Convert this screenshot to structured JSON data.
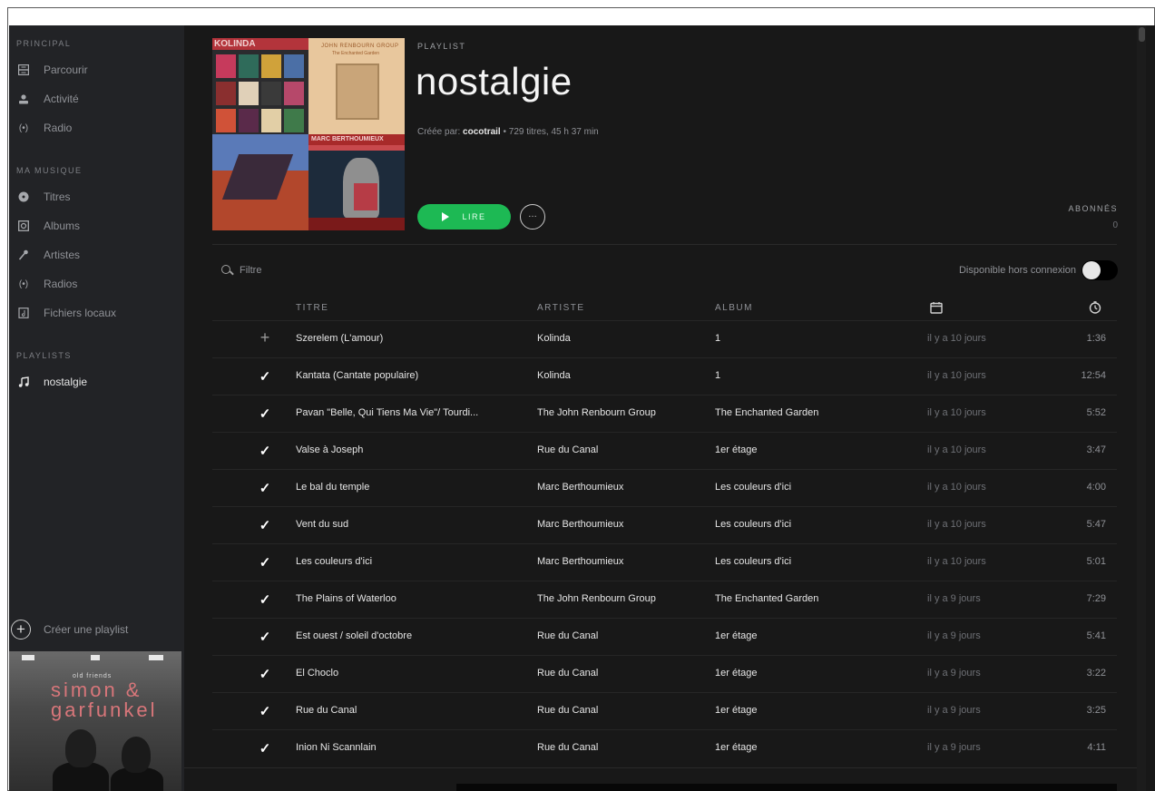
{
  "sidebar": {
    "sections": [
      {
        "title": "PRINCIPAL",
        "items": [
          {
            "label": "Parcourir",
            "icon": "browse-icon"
          },
          {
            "label": "Activité",
            "icon": "activity-icon"
          },
          {
            "label": "Radio",
            "icon": "radio-icon"
          }
        ]
      },
      {
        "title": "MA MUSIQUE",
        "items": [
          {
            "label": "Titres",
            "icon": "songs-icon"
          },
          {
            "label": "Albums",
            "icon": "albums-icon"
          },
          {
            "label": "Artistes",
            "icon": "artists-icon"
          },
          {
            "label": "Radios",
            "icon": "radios-icon"
          },
          {
            "label": "Fichiers locaux",
            "icon": "local-files-icon"
          }
        ]
      },
      {
        "title": "PLAYLISTS",
        "items": [
          {
            "label": "nostalgie",
            "icon": "playlist-icon"
          }
        ]
      }
    ],
    "create_playlist": "Créer une playlist",
    "now_playing_art": {
      "line1": "old friends",
      "line2": "simon &",
      "line3": "garfunkel"
    }
  },
  "playlist": {
    "type_label": "PLAYLIST",
    "title": "nostalgie",
    "created_by_label": "Créée par:",
    "owner": "cocotrail",
    "stats": "• 729 titres, 45 h 37 min",
    "play_label": "LIRE",
    "followers_label": "ABONNÉS",
    "followers_count": "0",
    "mosaic": {
      "tile1_title": "KOLINDA",
      "tile2_title": "JOHN RENBOURN GROUP",
      "tile2_sub": "The Enchanted Garden",
      "tile4_title": "MARC BERTHOUMIEUX"
    }
  },
  "filter": {
    "placeholder": "Filtre"
  },
  "offline": {
    "label": "Disponible hors connexion",
    "enabled": false
  },
  "table": {
    "headers": {
      "title": "TITRE",
      "artist": "ARTISTE",
      "album": "ALBUM"
    },
    "header_icons": {
      "date": "calendar-icon",
      "duration": "clock-icon"
    },
    "rows": [
      {
        "saved": false,
        "title": "Szerelem (L'amour)",
        "artist": "Kolinda",
        "album": "1",
        "added": "il y a 10 jours",
        "duration": "1:36"
      },
      {
        "saved": true,
        "title": "Kantata (Cantate populaire)",
        "artist": "Kolinda",
        "album": "1",
        "added": "il y a 10 jours",
        "duration": "12:54"
      },
      {
        "saved": true,
        "title": "Pavan \"Belle, Qui Tiens Ma Vie\"/ Tourdi...",
        "artist": "The John Renbourn Group",
        "album": "The Enchanted Garden",
        "added": "il y a 10 jours",
        "duration": "5:52"
      },
      {
        "saved": true,
        "title": "Valse à Joseph",
        "artist": "Rue du Canal",
        "album": "1er étage",
        "added": "il y a 10 jours",
        "duration": "3:47"
      },
      {
        "saved": true,
        "title": "Le bal du temple",
        "artist": "Marc Berthoumieux",
        "album": "Les couleurs d'ici",
        "added": "il y a 10 jours",
        "duration": "4:00"
      },
      {
        "saved": true,
        "title": "Vent du sud",
        "artist": "Marc Berthoumieux",
        "album": "Les couleurs d'ici",
        "added": "il y a 10 jours",
        "duration": "5:47"
      },
      {
        "saved": true,
        "title": "Les couleurs d'ici",
        "artist": "Marc Berthoumieux",
        "album": "Les couleurs d'ici",
        "added": "il y a 10 jours",
        "duration": "5:01"
      },
      {
        "saved": true,
        "title": "The Plains of Waterloo",
        "artist": "The John Renbourn Group",
        "album": "The Enchanted Garden",
        "added": "il y a 9 jours",
        "duration": "7:29"
      },
      {
        "saved": true,
        "title": "Est ouest / soleil d'octobre",
        "artist": "Rue du Canal",
        "album": "1er étage",
        "added": "il y a 9 jours",
        "duration": "5:41"
      },
      {
        "saved": true,
        "title": "El Choclo",
        "artist": "Rue du Canal",
        "album": "1er étage",
        "added": "il y a 9 jours",
        "duration": "3:22"
      },
      {
        "saved": true,
        "title": "Rue du Canal",
        "artist": "Rue du Canal",
        "album": "1er étage",
        "added": "il y a 9 jours",
        "duration": "3:25"
      },
      {
        "saved": true,
        "title": "Inion Ni Scannlain",
        "artist": "Rue du Canal",
        "album": "1er étage",
        "added": "il y a 9 jours",
        "duration": "4:11"
      }
    ]
  },
  "colors": {
    "accent": "#1db954",
    "background": "#181818",
    "sidebar": "#222326"
  }
}
